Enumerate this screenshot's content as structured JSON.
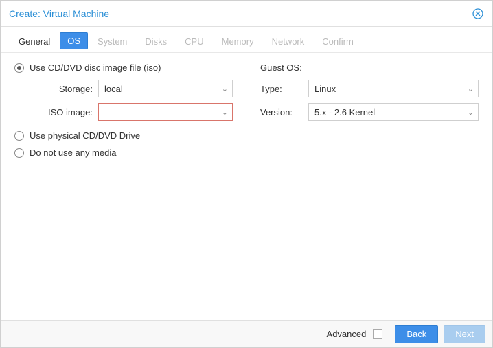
{
  "title": "Create: Virtual Machine",
  "tabs": {
    "general": "General",
    "os": "OS",
    "system": "System",
    "disks": "Disks",
    "cpu": "CPU",
    "memory": "Memory",
    "network": "Network",
    "confirm": "Confirm"
  },
  "media": {
    "iso_option": "Use CD/DVD disc image file (iso)",
    "physical_option": "Use physical CD/DVD Drive",
    "nomedia_option": "Do not use any media",
    "storage_label": "Storage:",
    "storage_value": "local",
    "iso_label": "ISO image:",
    "iso_value": ""
  },
  "guest": {
    "heading": "Guest OS:",
    "type_label": "Type:",
    "type_value": "Linux",
    "version_label": "Version:",
    "version_value": "5.x - 2.6 Kernel"
  },
  "footer": {
    "advanced_label": "Advanced",
    "back": "Back",
    "next": "Next"
  }
}
